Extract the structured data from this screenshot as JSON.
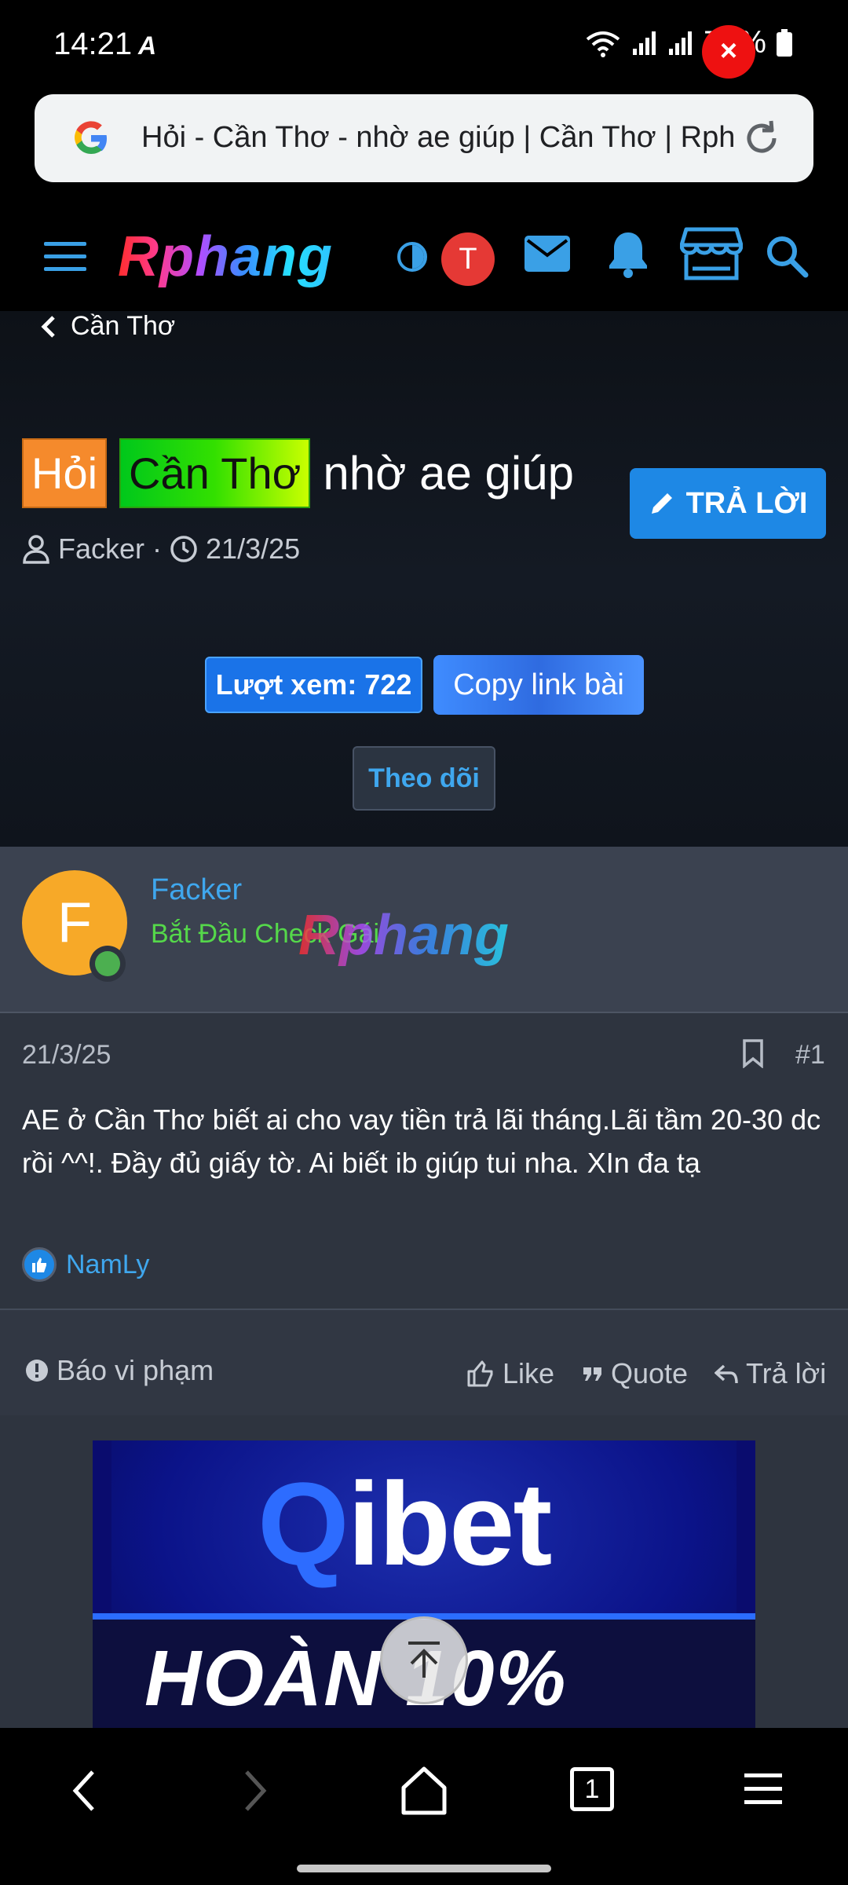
{
  "status_bar": {
    "time": "14:21",
    "a_glyph": "A",
    "battery": "70%"
  },
  "browser": {
    "url_title": "Hỏi - Cần Thơ - nhờ ae giúp | Cần Thơ | Rphang",
    "icons": [
      "google-g-icon",
      "reload-icon"
    ]
  },
  "site_header": {
    "logo": "Rphang",
    "avatar_letter": "T",
    "icons": [
      "menu-icon",
      "contrast-icon",
      "mail-icon",
      "bell-icon",
      "store-icon",
      "search-icon"
    ],
    "accent_color": "#3aa0e6"
  },
  "thread": {
    "breadcrumb": "Cần Thơ",
    "prefix_1": "Hỏi",
    "prefix_2": "Cần Thơ",
    "title": "nhờ ae giúp",
    "reply_button": "TRẢ LỜI",
    "author": "Facker",
    "separator": "·",
    "date": "21/3/25",
    "views_button": "Lượt xem: 722",
    "copy_link_button": "Copy link bài",
    "follow_button": "Theo dõi"
  },
  "post": {
    "avatar_letter": "F",
    "username": "Facker",
    "user_rank": "Bắt Đầu Check Gái",
    "watermark": "Rphang",
    "date": "21/3/25",
    "post_number": "#1",
    "body": "AE ở Cần Thơ biết ai cho vay tiền trả lãi tháng.Lãi tầm 20-30 dc rồi ^^!. Đầy đủ giấy tờ. Ai biết ib giúp tui nha. XIn đa tạ",
    "reaction_user": "NamLy",
    "report_label": "Báo vi phạm",
    "like_label": "Like",
    "quote_label": "Quote",
    "reply_label": "Trả lời"
  },
  "ad": {
    "logo_q": "Q",
    "logo_rest": "ibet",
    "band_text": "HOÀN 10%",
    "close": "×"
  },
  "bottom_nav": {
    "tab_count": "1",
    "icons": [
      "back-icon",
      "forward-icon",
      "home-icon",
      "tabs-icon",
      "menu-icon"
    ]
  }
}
